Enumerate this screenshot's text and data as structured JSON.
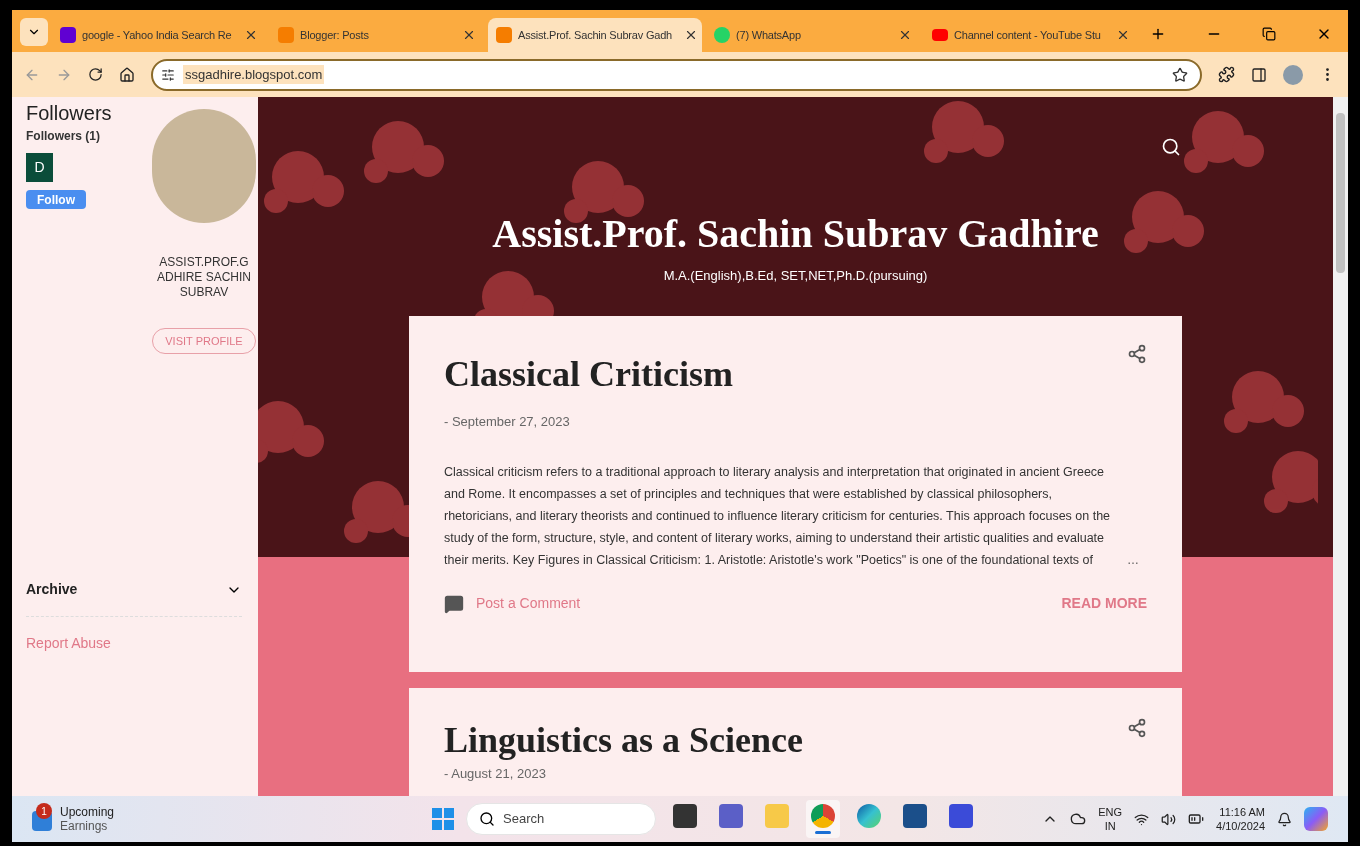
{
  "browser": {
    "tabs": [
      {
        "title": "google - Yahoo India Search Re",
        "kind": "yahoo",
        "selected": false
      },
      {
        "title": "Blogger: Posts",
        "kind": "blogger",
        "selected": false
      },
      {
        "title": "Assist.Prof. Sachin Subrav Gadh",
        "kind": "blogger",
        "selected": true
      },
      {
        "title": "(7) WhatsApp",
        "kind": "whatsapp",
        "selected": false
      },
      {
        "title": "Channel content - YouTube Stu",
        "kind": "youtube",
        "selected": false
      }
    ],
    "url": "ssgadhire.blogspot.com"
  },
  "sidebar": {
    "followers_title": "Followers",
    "followers_count": "Followers (1)",
    "follower_initial": "D",
    "follow_button": "Follow",
    "profile_name": "ASSIST.PROF.GADHIRE SACHIN SUBRAV",
    "visit_profile": "VISIT PROFILE",
    "archive": {
      "label": "Archive",
      "expanded": false
    },
    "report_abuse": "Report Abuse"
  },
  "header": {
    "title": "Assist.Prof. Sachin Subrav Gadhire",
    "subtitle": "M.A.(English),B.Ed, SET,NET,Ph.D.(pursuing)"
  },
  "posts": [
    {
      "title": "Classical Criticism",
      "date": "- September 27, 2023",
      "excerpt": " Classical criticism refers to a traditional approach to literary analysis and interpretation that originated in ancient Greece and Rome. It encompasses a set of principles and techniques that were established by classical philosophers, rhetoricians, and literary theorists and continued to influence literary criticism for centuries. This approach focuses on the study of the form, structure, style, and content of literary works, aiming to understand their artistic qualities and evaluate their merits. Key Figures in Classical Criticism: 1. Aristotle:  Aristotle's work \"Poetics\" is one of the foundational texts of",
      "ellipsis": "…",
      "comment_link": "Post a Comment",
      "read_more": "READ MORE"
    },
    {
      "title": "Linguistics as a Science",
      "date": "- August 21, 2023"
    }
  ],
  "taskbar": {
    "widget": {
      "badge": "1",
      "title": "Upcoming",
      "subtitle": "Earnings"
    },
    "search_placeholder": "Search",
    "apps": [
      {
        "kind": "taskview",
        "selected": false
      },
      {
        "kind": "teams",
        "selected": false
      },
      {
        "kind": "files",
        "selected": false
      },
      {
        "kind": "chrome",
        "selected": true
      },
      {
        "kind": "edge",
        "selected": false
      },
      {
        "kind": "store",
        "selected": false
      },
      {
        "kind": "editor",
        "selected": false
      }
    ],
    "language": "ENG",
    "region": "IN",
    "time": "11:16 AM",
    "date": "4/10/2024"
  }
}
